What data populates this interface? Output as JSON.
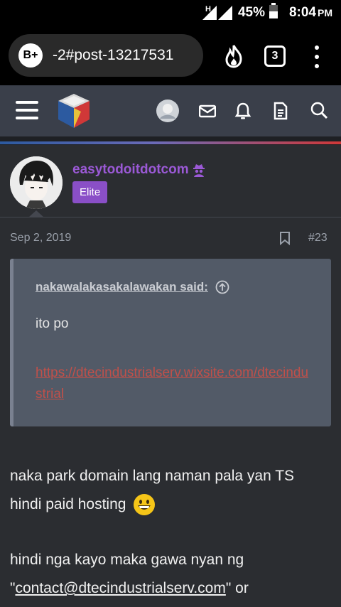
{
  "status_bar": {
    "network": "H",
    "battery": "45%",
    "time": "8:04",
    "ampm": "PM"
  },
  "browser": {
    "badge": "B+",
    "url": "-2#post-13217531",
    "tab_count": "3",
    "icons": [
      "fire-icon",
      "tabs-icon",
      "more-vert-icon"
    ]
  },
  "header": {
    "icons": [
      "menu-icon",
      "site-logo",
      "user-avatar",
      "inbox-icon",
      "bell-icon",
      "document-icon",
      "search-icon"
    ],
    "stripe_colors": [
      "#2c5aa0",
      "#6b6bb8",
      "#d03838"
    ]
  },
  "post": {
    "username": "easytodoitdotcom",
    "rank": "Elite",
    "date": "Sep 2, 2019",
    "post_number": "#23",
    "quote": {
      "author": "nakawalakasakalawakan said:",
      "text": "ito po",
      "link": "https://dtecindustrialserv.wixsite.com/dtecindustrial"
    },
    "paragraph1": "naka park domain lang naman pala yan TS hindi paid hosting",
    "paragraph2_prefix": "hindi nga kayo maka gawa nyan ng",
    "paragraph2_quote_open": "\"",
    "paragraph2_email": "contact@dtecindustrialserv.com",
    "paragraph2_suffix": "\" or"
  },
  "colors": {
    "username": "#9b59d6",
    "rank_badge": "#8a4fc7",
    "link": "#c0504a",
    "background": "#2b2d31",
    "header": "#3a3f4a",
    "quote_bg": "#525a67"
  }
}
